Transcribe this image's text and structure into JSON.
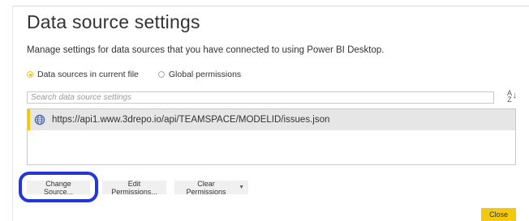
{
  "dialog": {
    "title": "Data source settings",
    "subtitle": "Manage settings for data sources that you have connected to using Power BI Desktop."
  },
  "scope_options": [
    {
      "label": "Data sources in current file",
      "selected": true
    },
    {
      "label": "Global permissions",
      "selected": false
    }
  ],
  "search": {
    "placeholder": "Search data source settings",
    "value": ""
  },
  "sort_button": {
    "icon": "sort-az-icon",
    "top": "A",
    "bottom": "Z"
  },
  "data_sources": [
    {
      "icon": "globe-icon",
      "label": "https://api1.www.3drepo.io/api/TEAMSPACE/MODELID/issues.json",
      "selected": true
    }
  ],
  "actions": {
    "change_source": "Change Source...",
    "edit_permissions": "Edit Permissions...",
    "clear_permissions": "Clear Permissions",
    "close": "Close"
  },
  "colors": {
    "accent": "#f2c811",
    "highlight_ring": "#2436d8",
    "selected_row": "#e6e6e6"
  }
}
